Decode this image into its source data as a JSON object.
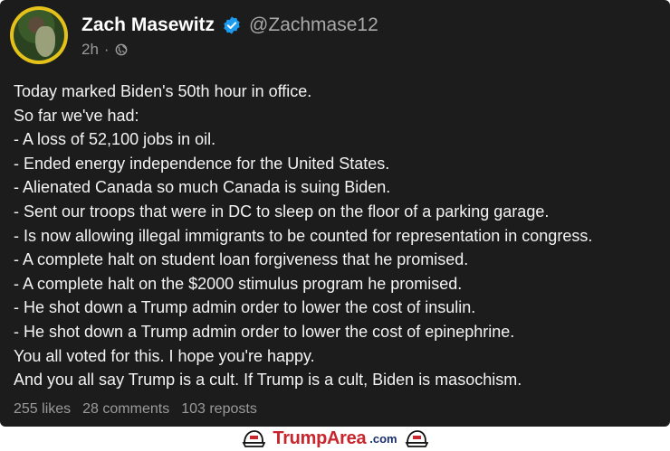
{
  "post": {
    "author_name": "Zach Masewitz",
    "handle": "@Zachmase12",
    "time": "2h",
    "separator": "·",
    "lines": [
      "Today marked Biden's 50th hour in office.",
      "So far we've had:",
      "- A loss of 52,100 jobs in oil.",
      "- Ended energy independence for the United States.",
      "- Alienated Canada so much Canada is suing Biden.",
      "- Sent our troops that were in DC to sleep on the floor of a parking garage.",
      "- Is now allowing illegal immigrants to be counted for representation in congress.",
      "- A complete halt on student loan forgiveness that he promised.",
      "- A complete halt on the $2000 stimulus program he promised.",
      "- He shot down a Trump admin order to lower the cost of insulin.",
      "- He shot down a Trump admin order to lower the cost of epinephrine.",
      "You all voted for this. I hope you're happy.",
      "And you all say Trump is a cult. If Trump is a cult, Biden is masochism."
    ],
    "likes": "255 likes",
    "comments": "28 comments",
    "reposts": "103 reposts"
  },
  "watermark": {
    "brand": "TrumpArea",
    "tld": ".com"
  },
  "colors": {
    "post_bg": "#1c1c1c",
    "verified_badge": "#1d9bf0",
    "brand_red": "#c8262c",
    "brand_blue": "#1a2f6b"
  },
  "icons": [
    "verified-badge-icon",
    "globe-icon",
    "cap-icon"
  ]
}
